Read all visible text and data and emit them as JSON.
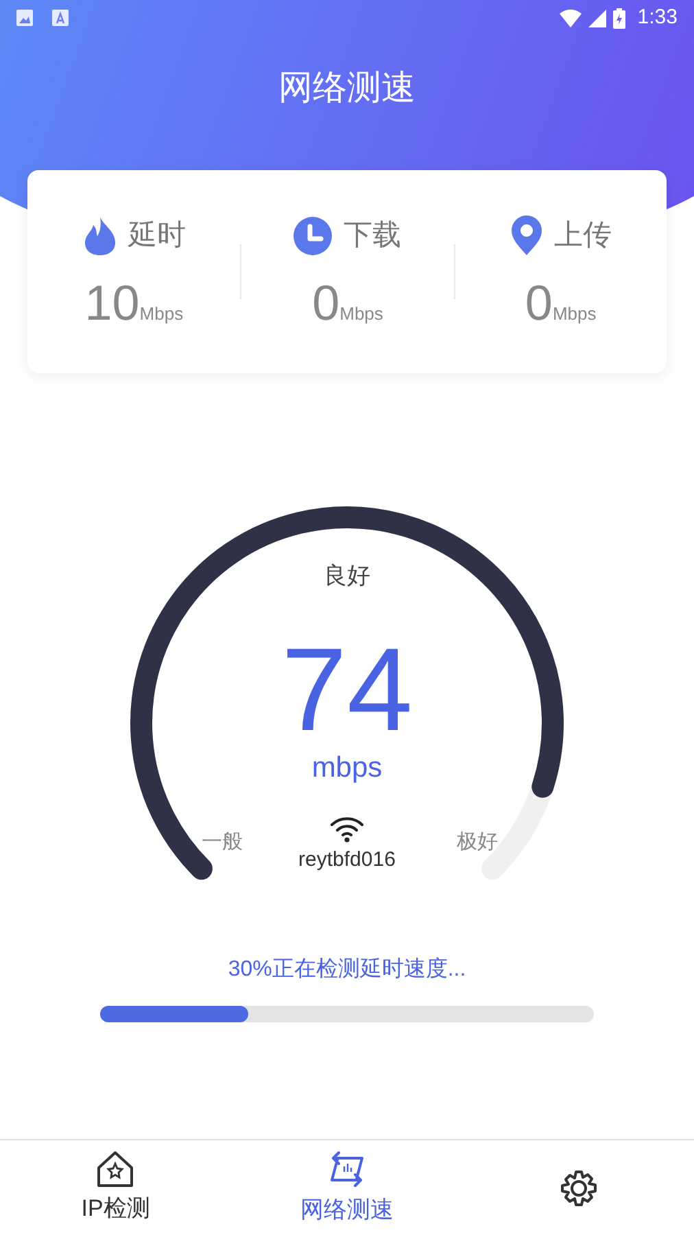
{
  "status_bar": {
    "time": "1:33"
  },
  "header": {
    "title": "网络测速"
  },
  "stats": [
    {
      "kind": "latency",
      "label": "延时",
      "value": "10",
      "unit": "Mbps"
    },
    {
      "kind": "download",
      "label": "下载",
      "value": "0",
      "unit": "Mbps"
    },
    {
      "kind": "upload",
      "label": "上传",
      "value": "0",
      "unit": "Mbps"
    }
  ],
  "gauge": {
    "rating": "良好",
    "speed": "74",
    "unit": "mbps",
    "min_label": "一般",
    "max_label": "极好",
    "network": "reytbfd016"
  },
  "progress": {
    "text": "30%正在检测延时速度...",
    "level": 0.3
  },
  "tabs": [
    {
      "kind": "ip",
      "label": "IP检测",
      "selected": false
    },
    {
      "kind": "speed",
      "label": "网络测速",
      "selected": true
    },
    {
      "kind": "settings",
      "selected": false
    }
  ]
}
